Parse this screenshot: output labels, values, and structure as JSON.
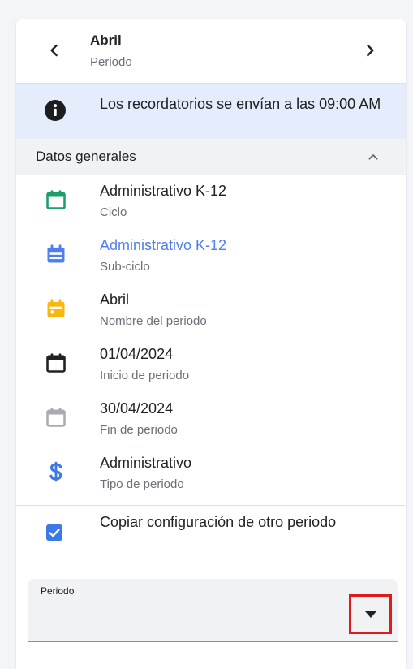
{
  "header": {
    "title": "Abril",
    "subtitle": "Periodo",
    "prev_icon": "chevron-left-icon",
    "next_icon": "chevron-right-icon"
  },
  "banner": {
    "icon": "info-icon",
    "text": "Los recordatorios se envían a las 09:00 AM"
  },
  "section": {
    "title": "Datos generales",
    "toggle_icon": "chevron-up-icon"
  },
  "fields": [
    {
      "value": "Administrativo K-12",
      "label": "Ciclo",
      "icon": "calendar-blank-icon",
      "color": "#1e9e6a"
    },
    {
      "value": "Administrativo K-12",
      "label": "Sub-ciclo",
      "icon": "calendar-icon",
      "color": "#4f7ef0"
    },
    {
      "value": "Abril",
      "label": "Nombre del periodo",
      "icon": "calendar-icon",
      "color": "#f9b70c"
    },
    {
      "value": "01/04/2024",
      "label": "Inicio de periodo",
      "icon": "calendar-blank-icon",
      "color": "#202124"
    },
    {
      "value": "30/04/2024",
      "label": "Fin de periodo",
      "icon": "calendar-blank-icon",
      "color": "#a8abb0"
    },
    {
      "value": "Administrativo",
      "label": "Tipo de periodo",
      "icon": "dollar-icon",
      "color": "#3d79e6"
    }
  ],
  "copy_config": {
    "label": "Copiar configuración de otro periodo",
    "checked": true,
    "color": "#3d79e6"
  },
  "period_select": {
    "label": "Periodo",
    "value": "",
    "icon": "caret-down-icon"
  }
}
